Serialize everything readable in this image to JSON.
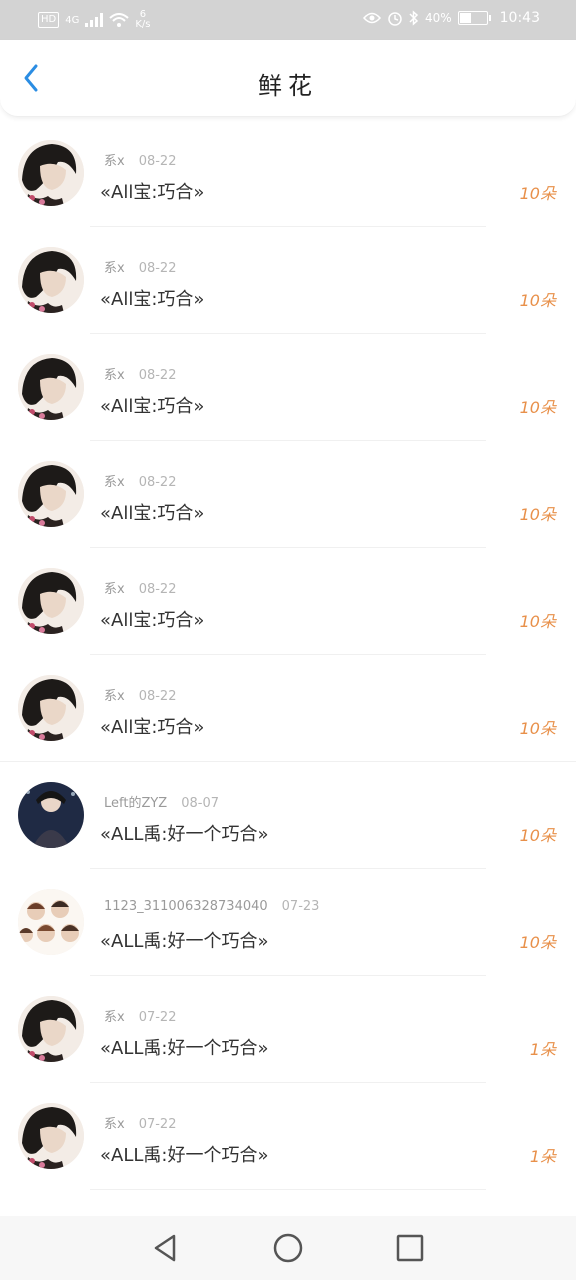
{
  "status_bar": {
    "left": {
      "hd": "HD",
      "network": "4G",
      "speed_value": "6",
      "speed_unit": "K/s"
    },
    "right": {
      "battery": "40%",
      "time": "10:43"
    }
  },
  "header": {
    "title": "鲜花"
  },
  "list": [
    {
      "name": "系x",
      "date": "08-22",
      "message": "«All宝:巧合»",
      "count": "10朵",
      "avatar": "dark-hair"
    },
    {
      "name": "系x",
      "date": "08-22",
      "message": "«All宝:巧合»",
      "count": "10朵",
      "avatar": "dark-hair"
    },
    {
      "name": "系x",
      "date": "08-22",
      "message": "«All宝:巧合»",
      "count": "10朵",
      "avatar": "dark-hair"
    },
    {
      "name": "系x",
      "date": "08-22",
      "message": "«All宝:巧合»",
      "count": "10朵",
      "avatar": "dark-hair"
    },
    {
      "name": "系x",
      "date": "08-22",
      "message": "«All宝:巧合»",
      "count": "10朵",
      "avatar": "dark-hair"
    },
    {
      "name": "系x",
      "date": "08-22",
      "message": "«All宝:巧合»",
      "count": "10朵",
      "avatar": "dark-hair"
    },
    {
      "name": "Left的ZYZ",
      "date": "08-07",
      "message": "«ALL禹:好一个巧合»",
      "count": "10朵",
      "avatar": "stage"
    },
    {
      "name": "1123_311006328734040",
      "date": "07-23",
      "message": "«ALL禹:好一个巧合»",
      "count": "10朵",
      "avatar": "group"
    },
    {
      "name": "系x",
      "date": "07-22",
      "message": "«ALL禹:好一个巧合»",
      "count": "1朵",
      "avatar": "dark-hair"
    },
    {
      "name": "系x",
      "date": "07-22",
      "message": "«ALL禹:好一个巧合»",
      "count": "1朵",
      "avatar": "dark-hair"
    }
  ],
  "colors": {
    "accent": "#2b8de3",
    "count": "#e8904a",
    "status_bar": "#d3d3d3"
  },
  "nav": {
    "back": "back-icon",
    "home": "home-icon",
    "recent": "recent-apps-icon"
  }
}
